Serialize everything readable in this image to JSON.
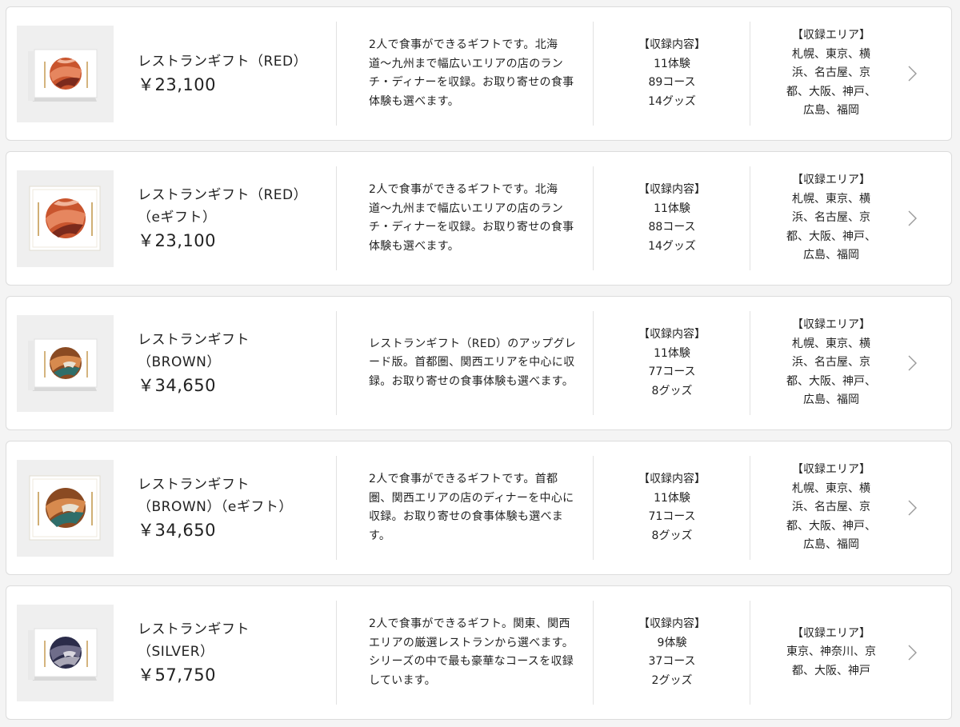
{
  "colors": {
    "card_bg": "#ffffff",
    "border": "#dcdcdc",
    "text": "#222222",
    "chevron": "#9a9a9a"
  },
  "products": [
    {
      "title_lines": [
        "レストランギフト（RED）"
      ],
      "price": "￥23,100",
      "description": "2人で食事ができるギフトです。北海道〜九州まで幅広いエリアの店のランチ・ディナーを収録。お取り寄せの食事体験も選べます。",
      "contents_heading": "【収録内容】",
      "contents": [
        "11体験",
        "89コース",
        "14グッズ"
      ],
      "area_heading": "【収録エリア】",
      "area": "札幌、東京、横浜、名古屋、京都、大阪、神戸、広島、福岡",
      "image_icon": "red-plate-box-icon"
    },
    {
      "title_lines": [
        "レストランギフト（RED）",
        "（eギフト）"
      ],
      "price": "￥23,100",
      "description": "2人で食事ができるギフトです。北海道〜九州まで幅広いエリアの店のランチ・ディナーを収録。お取り寄せの食事体験も選べます。",
      "contents_heading": "【収録内容】",
      "contents": [
        "11体験",
        "88コース",
        "14グッズ"
      ],
      "area_heading": "【収録エリア】",
      "area": "札幌、東京、横浜、名古屋、京都、大阪、神戸、広島、福岡",
      "image_icon": "red-plate-card-icon"
    },
    {
      "title_lines": [
        "レストランギフト",
        "（BROWN）"
      ],
      "price": "￥34,650",
      "description": "レストランギフト（RED）のアップグレード版。首都圏、関西エリアを中心に収録。お取り寄せの食事体験も選べます。",
      "contents_heading": "【収録内容】",
      "contents": [
        "11体験",
        "77コース",
        "8グッズ"
      ],
      "area_heading": "【収録エリア】",
      "area": "札幌、東京、横浜、名古屋、京都、大阪、神戸、広島、福岡",
      "image_icon": "brown-plate-box-icon"
    },
    {
      "title_lines": [
        "レストランギフト",
        "（BROWN）（eギフト）"
      ],
      "price": "￥34,650",
      "description": "2人で食事ができるギフトです。首都圏、関西エリアの店のディナーを中心に収録。お取り寄せの食事体験も選べます。",
      "contents_heading": "【収録内容】",
      "contents": [
        "11体験",
        "71コース",
        "8グッズ"
      ],
      "area_heading": "【収録エリア】",
      "area": "札幌、東京、横浜、名古屋、京都、大阪、神戸、広島、福岡",
      "image_icon": "brown-plate-card-icon"
    },
    {
      "title_lines": [
        "レストランギフト",
        "（SILVER）"
      ],
      "price": "￥57,750",
      "description": "2人で食事ができるギフト。関東、関西エリアの厳選レストランから選べます。シリーズの中で最も豪華なコースを収録しています。",
      "contents_heading": "【収録内容】",
      "contents": [
        "9体験",
        "37コース",
        "2グッズ"
      ],
      "area_heading": "【収録エリア】",
      "area": "東京、神奈川、京都、大阪、神戸",
      "image_icon": "silver-plate-box-icon"
    }
  ]
}
